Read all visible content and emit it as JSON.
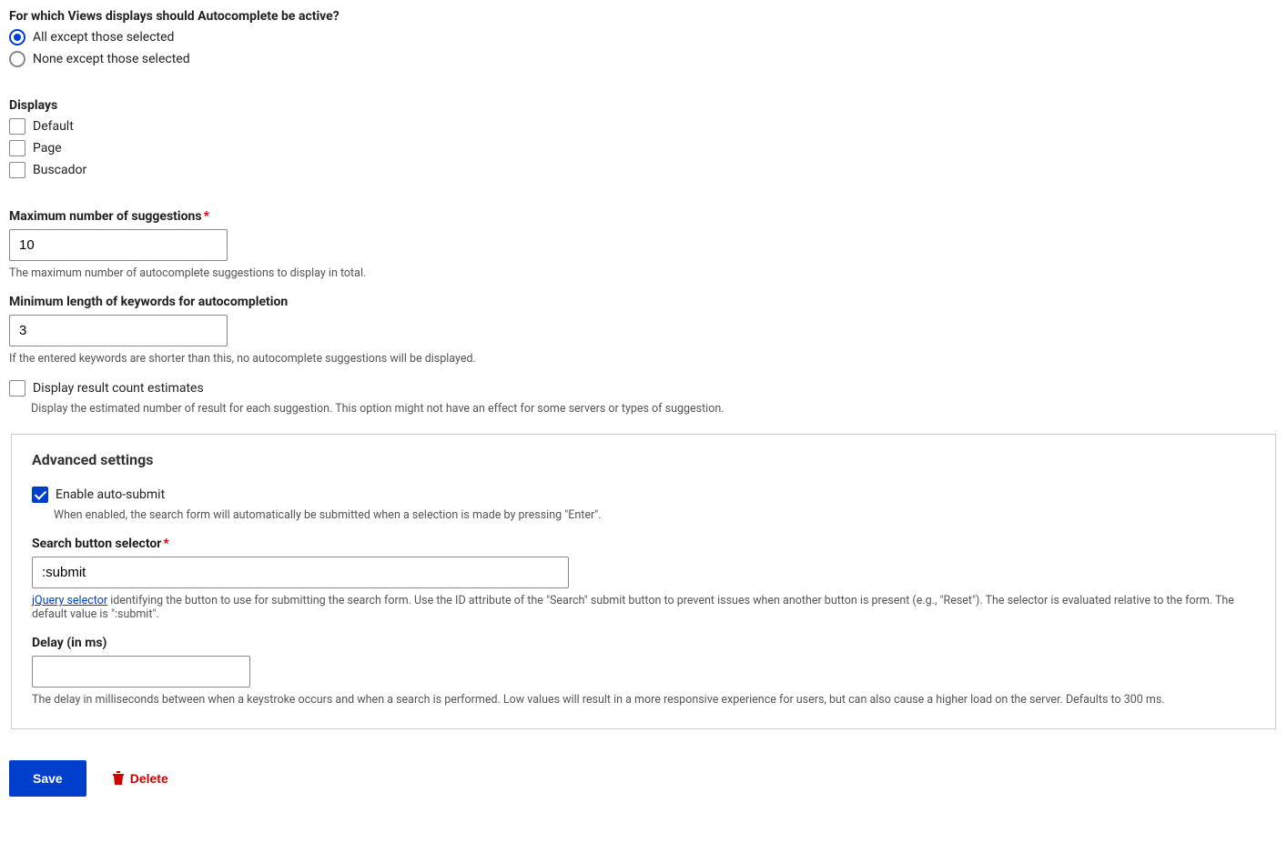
{
  "views_active": {
    "heading": "For which Views displays should Autocomplete be active?",
    "options": [
      {
        "label": "All except those selected",
        "checked": true
      },
      {
        "label": "None except those selected",
        "checked": false
      }
    ]
  },
  "displays": {
    "heading": "Displays",
    "items": [
      {
        "label": "Default",
        "checked": false
      },
      {
        "label": "Page",
        "checked": false
      },
      {
        "label": "Buscador",
        "checked": false
      }
    ]
  },
  "max_suggestions": {
    "label": "Maximum number of suggestions",
    "value": "10",
    "description": "The maximum number of autocomplete suggestions to display in total."
  },
  "min_length": {
    "label": "Minimum length of keywords for autocompletion",
    "value": "3",
    "description": "If the entered keywords are shorter than this, no autocomplete suggestions will be displayed."
  },
  "result_count": {
    "label": "Display result count estimates",
    "checked": false,
    "description": "Display the estimated number of result for each suggestion. This option might not have an effect for some servers or types of suggestion."
  },
  "advanced": {
    "heading": "Advanced settings",
    "auto_submit": {
      "label": "Enable auto-submit",
      "checked": true,
      "description": "When enabled, the search form will automatically be submitted when a selection is made by pressing \"Enter\"."
    },
    "search_button_selector": {
      "label": "Search button selector",
      "value": ":submit",
      "link_text": "jQuery selector",
      "description_rest": " identifying the button to use for submitting the search form. Use the ID attribute of the \"Search\" submit button to prevent issues when another button is present (e.g., \"Reset\"). The selector is evaluated relative to the form. The default value is \":submit\"."
    },
    "delay": {
      "label": "Delay (in ms)",
      "value": "",
      "description": "The delay in milliseconds between when a keystroke occurs and when a search is performed. Low values will result in a more responsive experience for users, but can also cause a higher load on the server. Defaults to 300 ms."
    }
  },
  "actions": {
    "save": "Save",
    "delete": "Delete"
  }
}
